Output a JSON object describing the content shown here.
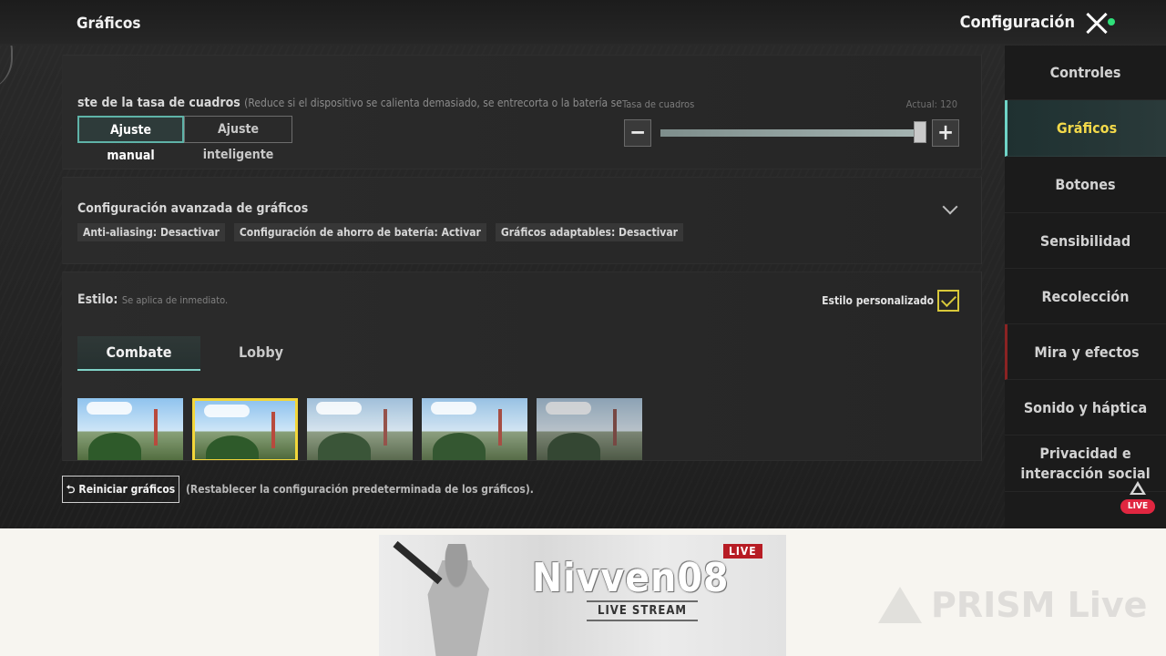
{
  "topbar": {
    "section_title": "Gráficos",
    "config_title": "Configuración"
  },
  "fps": {
    "label": "ste de la tasa de cuadros",
    "hint": "(Reduce si el dispositivo se calienta demasiado, se entrecorta o la batería se agot",
    "manual_label": "Ajuste manual",
    "smart_label": "Ajuste inteligente",
    "slider_title": "Tasa de cuadros",
    "slider_actual": "Actual: 120",
    "slider_level": 0.99,
    "minus_symbol": "−",
    "plus_symbol": "+"
  },
  "advanced": {
    "title": "Configuración avanzada de gráficos",
    "chips": [
      "Anti-aliasing: Desactivar",
      "Configuración de ahorro de batería: Activar",
      "Gráficos adaptables: Desactivar"
    ]
  },
  "style": {
    "label": "Estilo:",
    "hint": "Se aplica de inmediato.",
    "custom_label": "Estilo personalizado",
    "custom_checked": true,
    "tabs": [
      "Combate",
      "Lobby"
    ],
    "selected_thumbnail": 2
  },
  "reset": {
    "button_label": "Reiniciar gráficos",
    "note": "(Restablecer la configuración predeterminada de los gráficos)."
  },
  "sidebar": {
    "items": [
      {
        "label": "Controles"
      },
      {
        "label": "Gráficos",
        "active": true
      },
      {
        "label": "Botones"
      },
      {
        "label": "Sensibilidad"
      },
      {
        "label": "Recolección"
      },
      {
        "label": "Mira y efectos"
      },
      {
        "label": "Sonido y háptica"
      },
      {
        "label": "Privacidad e interacción social"
      }
    ]
  },
  "overlay": {
    "live_badge": "LIVE"
  },
  "banner": {
    "name": "Nivven08",
    "live_tag": "LIVE",
    "subtitle": "LIVE STREAM"
  },
  "watermark": {
    "text": "PRISM Live"
  },
  "colors": {
    "accent_teal": "#6fd4c7",
    "active_yellow": "#f3d94a",
    "live_red": "#e02640"
  }
}
